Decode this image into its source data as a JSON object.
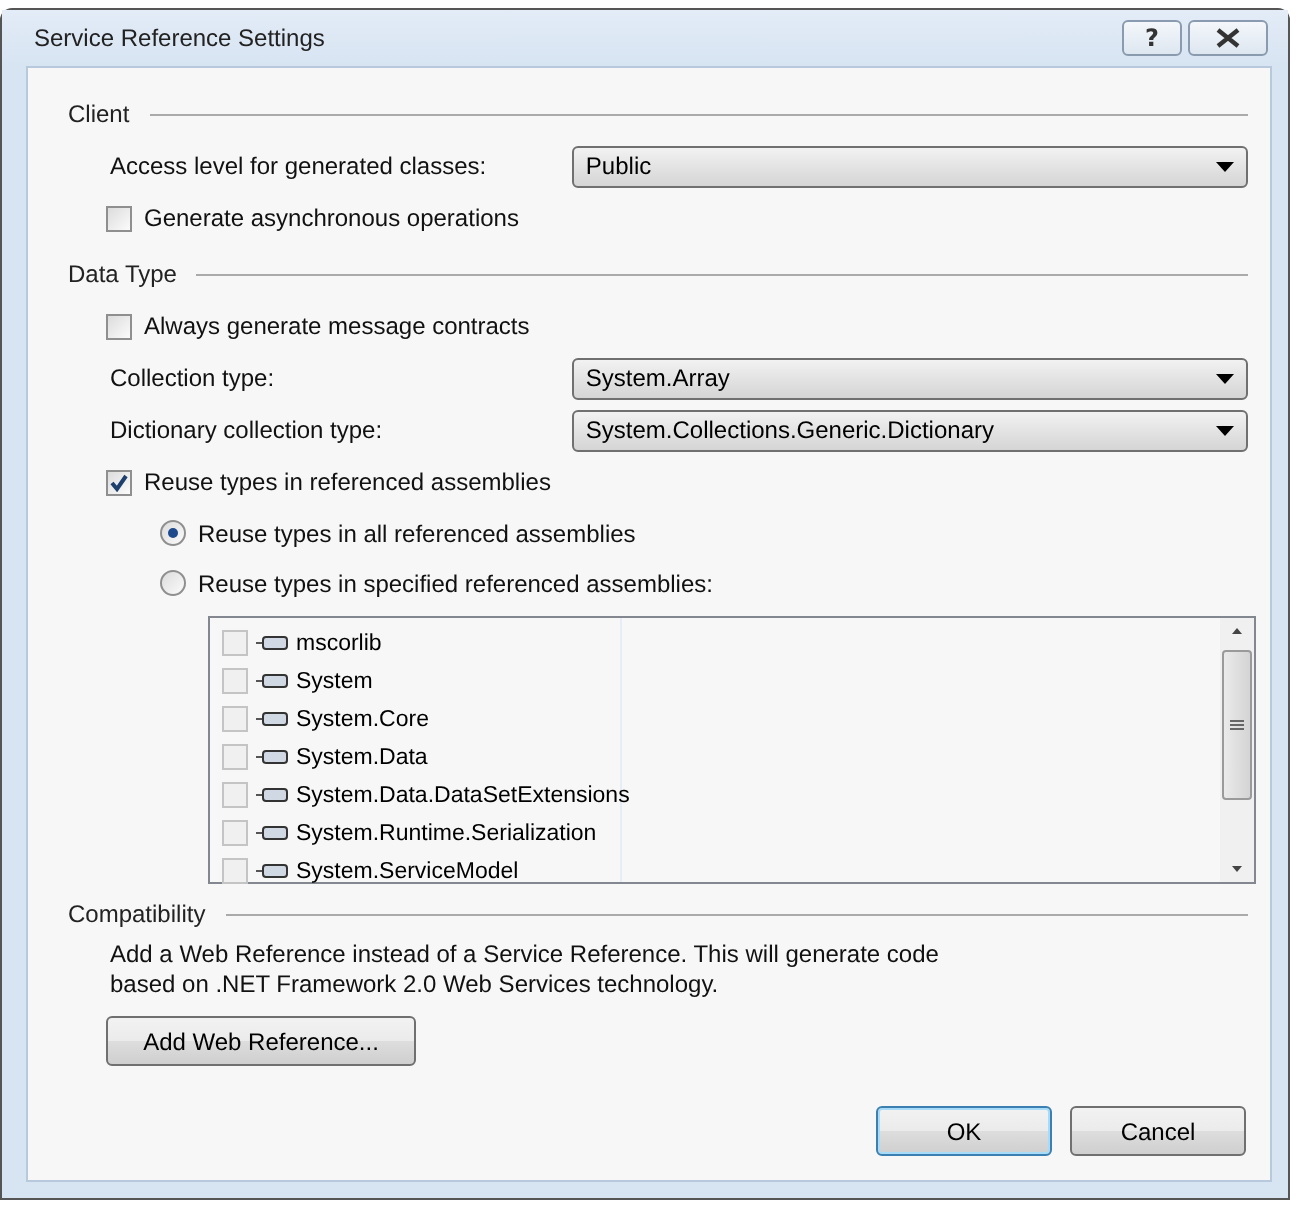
{
  "window": {
    "title": "Service Reference Settings",
    "help_button": "?"
  },
  "sections": [
    {
      "title": "Client",
      "rows": [
        {
          "kind": "combo",
          "label": "Access level for generated classes:",
          "value": "Public"
        },
        {
          "kind": "checkbox",
          "label": "Generate asynchronous operations",
          "checked": false
        }
      ]
    },
    {
      "title": "Data Type",
      "rows": [
        {
          "kind": "checkbox",
          "label": "Always generate message contracts",
          "checked": false
        },
        {
          "kind": "combo",
          "label": "Collection type:",
          "value": "System.Array"
        },
        {
          "kind": "combo",
          "label": "Dictionary collection type:",
          "value": "System.Collections.Generic.Dictionary"
        },
        {
          "kind": "checkbox",
          "label": "Reuse types in referenced assemblies",
          "checked": true
        },
        {
          "kind": "radio",
          "label": "Reuse types in all referenced assemblies",
          "selected": true
        },
        {
          "kind": "radio",
          "label": "Reuse types in specified referenced assemblies:",
          "selected": false
        },
        {
          "kind": "assemblies",
          "disabled": true,
          "items": [
            {
              "label": "mscorlib",
              "checked": false
            },
            {
              "label": "System",
              "checked": false
            },
            {
              "label": "System.Core",
              "checked": false
            },
            {
              "label": "System.Data",
              "checked": false
            },
            {
              "label": "System.Data.DataSetExtensions",
              "checked": false
            },
            {
              "label": "System.Runtime.Serialization",
              "checked": false
            },
            {
              "label": "System.ServiceModel",
              "checked": false
            }
          ]
        }
      ]
    },
    {
      "title": "Compatibility",
      "rows": [
        {
          "kind": "text",
          "text": "Add a Web Reference instead of a Service Reference. This will generate code based on .NET Framework 2.0 Web Services technology."
        },
        {
          "kind": "button",
          "label": "Add Web Reference..."
        }
      ]
    }
  ],
  "footer_buttons": [
    {
      "label": "OK",
      "default": true
    },
    {
      "label": "Cancel",
      "default": false
    }
  ]
}
